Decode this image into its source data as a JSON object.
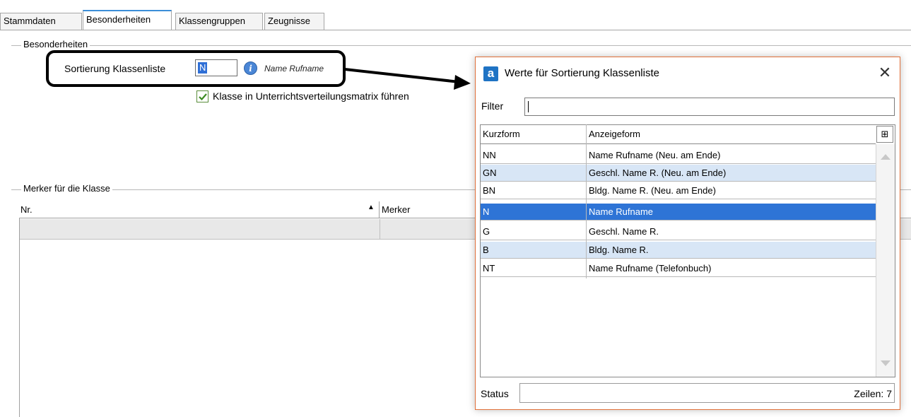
{
  "tabs": [
    "Stammdaten",
    "Besonderheiten",
    "Klassengruppen",
    "Zeugnisse"
  ],
  "active_tab": "Besonderheiten",
  "besonderheiten": {
    "group_label": "Besonderheiten",
    "sort_label": "Sortierung Klassenliste",
    "sort_value": "N",
    "sort_hint": "Name Rufname",
    "checkbox_label": "Klasse in Unterrichtsverteilungsmatrix führen",
    "checkbox_checked": true
  },
  "merker": {
    "group_label": "Merker für die Klasse",
    "columns": [
      "Nr.",
      "Merker"
    ],
    "sort_indicator": "▲"
  },
  "dialog": {
    "title": "Werte für Sortierung Klassenliste",
    "filter_label": "Filter",
    "filter_value": "",
    "columns": [
      "Kurzform",
      "Anzeigeform"
    ],
    "rows": [
      {
        "kurzform": "NN",
        "anzeigeform": "Name Rufname (Neu. am Ende)"
      },
      {
        "kurzform": "GN",
        "anzeigeform": "Geschl. Name R. (Neu. am Ende)"
      },
      {
        "kurzform": "BN",
        "anzeigeform": "Bldg. Name R. (Neu. am Ende)"
      },
      {
        "kurzform": "N",
        "anzeigeform": "Name Rufname"
      },
      {
        "kurzform": "G",
        "anzeigeform": "Geschl. Name R."
      },
      {
        "kurzform": "B",
        "anzeigeform": "Bldg. Name R."
      },
      {
        "kurzform": "NT",
        "anzeigeform": "Name Rufname (Telefonbuch)"
      }
    ],
    "selected_row": "N",
    "status_label": "Status",
    "row_count": "Zeilen: 7",
    "logo_glyph": "a",
    "close_glyph": "✕"
  },
  "colors": {
    "accent": "#2e74d6",
    "alt_row": "#d8e6f6",
    "dialog_border": "#e0703a"
  }
}
